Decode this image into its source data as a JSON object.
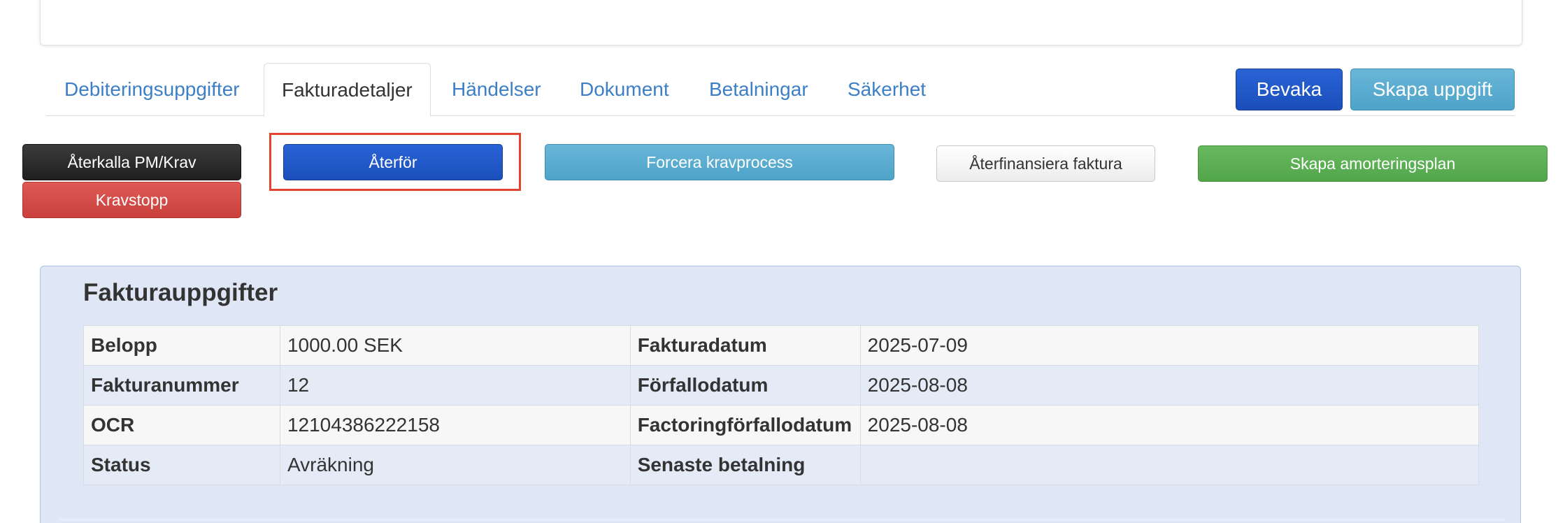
{
  "tabs": [
    {
      "label": "Debiteringsuppgifter"
    },
    {
      "label": "Fakturadetaljer"
    },
    {
      "label": "Händelser"
    },
    {
      "label": "Dokument"
    },
    {
      "label": "Betalningar"
    },
    {
      "label": "Säkerhet"
    }
  ],
  "header_actions": {
    "bevaka": "Bevaka",
    "skapa_uppgift": "Skapa uppgift"
  },
  "actions": {
    "aterkalla": "Återkalla PM/Krav",
    "kravstopp": "Kravstopp",
    "aterfor": "Återför",
    "forcera": "Forcera kravprocess",
    "aterfinansiera": "Återfinansiera faktura",
    "amorteringsplan": "Skapa amorteringsplan"
  },
  "invoice": {
    "title": "Fakturauppgifter",
    "rows": [
      {
        "label1": "Belopp",
        "value1": "1000.00 SEK",
        "label2": "Fakturadatum",
        "value2": "2025-07-09"
      },
      {
        "label1": "Fakturanummer",
        "value1": "12",
        "label2": "Förfallodatum",
        "value2": "2025-08-08"
      },
      {
        "label1": "OCR",
        "value1": "12104386222158",
        "label2": "Factoringförfallodatum",
        "value2": "2025-08-08"
      },
      {
        "label1": "Status",
        "value1": "Avräkning",
        "label2": "Senaste betalning",
        "value2": ""
      }
    ]
  },
  "colors": {
    "link": "#3c7fc6",
    "primary": "#1a4fba",
    "info": "#4ea3c8",
    "danger": "#c9403c",
    "success": "#52a64a",
    "highlight": "#e2452d",
    "panel_bg": "#dfe7f6"
  }
}
